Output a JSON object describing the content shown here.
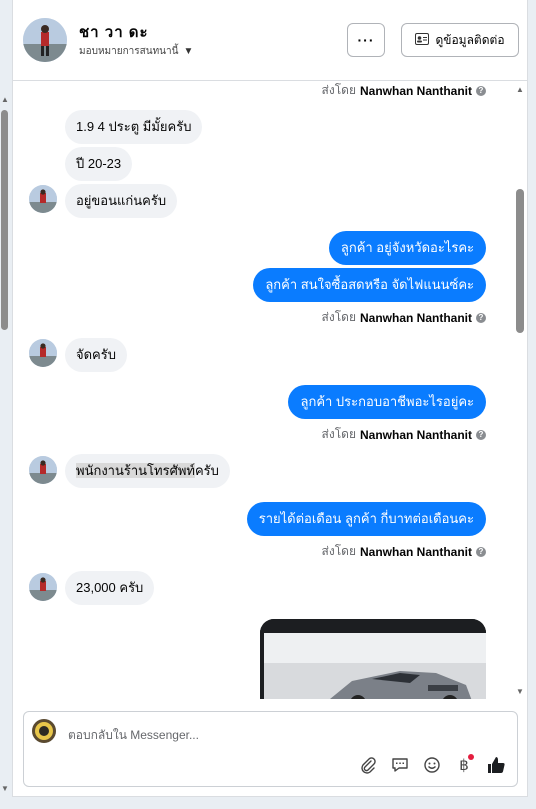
{
  "header": {
    "contact_name": "ชา วา ดะ",
    "assigned_label": "มอบหมายการสนทนานี้",
    "more_label": "···",
    "contact_info_label": "ดูข้อมูลติดต่อ"
  },
  "messages": {
    "sent_by_prefix": "ส่งโดย",
    "sender_name": "Nanwhan Nanthanit",
    "top_sent_by_name": "Nanwhan Nanthanit",
    "in_1": "1.9 4 ประตู มีมั้ยครับ",
    "in_2": "ปี 20-23",
    "in_3": "อยู่ขอนแก่นครับ",
    "out_1": "ลูกค้า  อยู่จังหวัดอะไรคะ",
    "out_2": "ลูกค้า สนใจซื้อสดหรือ จัดไฟแนนซ์คะ",
    "in_4": "จัดครับ",
    "out_3": "ลูกค้า ประกอบอาชีพอะไรอยู่คะ",
    "in_5_highlight": "พนักงานร้านโทรศัพท์",
    "in_5_rest": "ครับ",
    "out_4": "รายได้ต่อเดือน ลูกค้า  กี่บาทต่อเดือนคะ",
    "in_6": "23,000 ครับ"
  },
  "composer": {
    "placeholder": "ตอบกลับใน Messenger..."
  },
  "icons": {
    "attach": "paperclip-icon",
    "saved_reply": "chat-bubble-icon",
    "emoji": "smiley-icon",
    "payment": "baht-icon",
    "like": "thumbs-up-icon"
  },
  "colors": {
    "outgoing_bubble": "#0a7cff",
    "incoming_bubble": "#f0f2f5",
    "notification_dot": "#e41e3f"
  }
}
